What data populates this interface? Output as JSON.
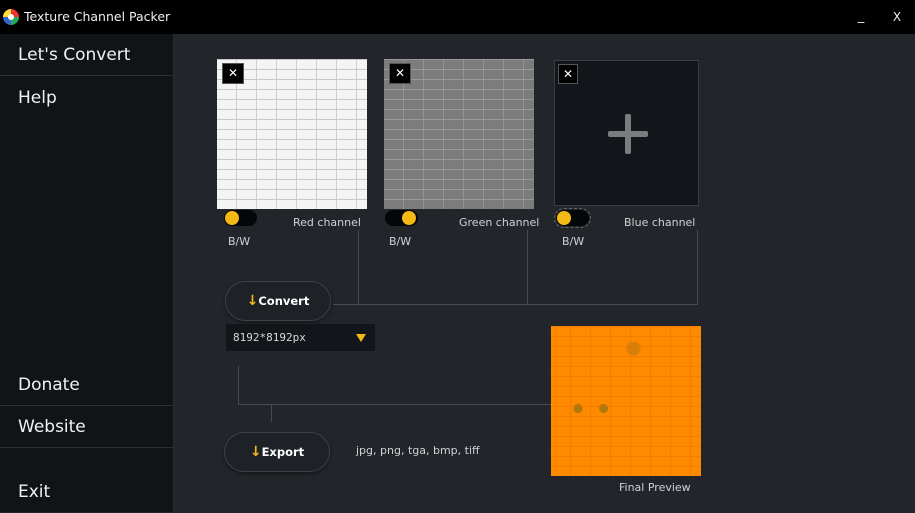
{
  "window": {
    "title": "Texture Channel Packer",
    "minimize_label": "_",
    "close_label": "X"
  },
  "sidebar": {
    "items": [
      {
        "label": "Let's Convert"
      },
      {
        "label": "Help"
      },
      {
        "label": "Donate"
      },
      {
        "label": "Website"
      },
      {
        "label": "Exit"
      }
    ]
  },
  "channels": [
    {
      "name": "Red channel",
      "toggle_label": "B/W",
      "toggle_state": "left",
      "has_image": true,
      "remove_label": "✕"
    },
    {
      "name": "Green channel",
      "toggle_label": "B/W",
      "toggle_state": "right",
      "has_image": true,
      "remove_label": "✕"
    },
    {
      "name": "Blue channel",
      "toggle_label": "B/W",
      "toggle_state": "left",
      "has_image": false,
      "remove_label": "✕"
    }
  ],
  "convert": {
    "arrow": "↓",
    "label": "Convert"
  },
  "resolution": {
    "selected": "8192*8192px"
  },
  "export": {
    "arrow": "↓",
    "label": "Export",
    "formats": "jpg, png, tga, bmp, tiff"
  },
  "preview": {
    "label": "Final Preview"
  },
  "colors": {
    "accent": "#f5b915",
    "background": "#22262b",
    "sidebar": "#111417",
    "preview_fill": "#ff8a00"
  }
}
